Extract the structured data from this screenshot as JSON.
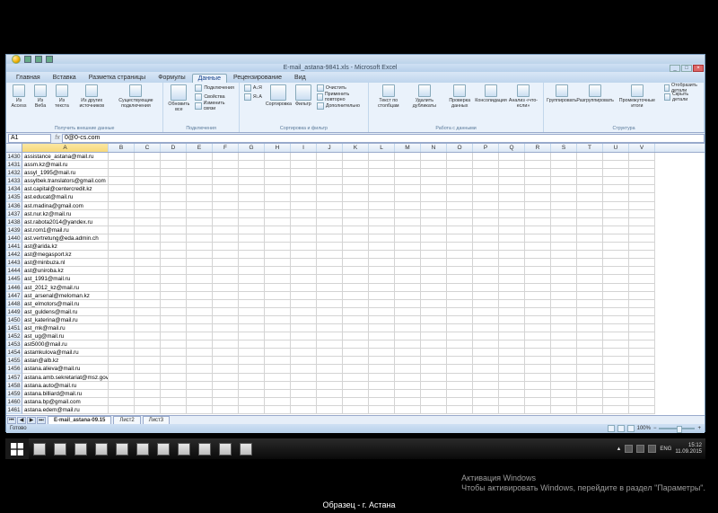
{
  "letterbox_caption": "Образец - г. Астана",
  "activation": {
    "title": "Активация Windows",
    "msg": "Чтобы активировать Windows, перейдите в раздел \"Параметры\"."
  },
  "window": {
    "doc_title": "E-mail_astana-9841.xls - Microsoft Excel",
    "min": "_",
    "max": "□",
    "close": "×"
  },
  "tabs": {
    "items": [
      "Главная",
      "Вставка",
      "Разметка страницы",
      "Формулы",
      "Данные",
      "Рецензирование",
      "Вид"
    ],
    "active_index": 4
  },
  "ribbon": {
    "g0": {
      "label": "Получить внешние данные",
      "b": [
        "Из Access",
        "Из Веба",
        "Из текста",
        "Из других источников",
        "Существующие подключения"
      ]
    },
    "g1": {
      "label": "Подключения",
      "big": "Обновить все",
      "s": [
        "Подключения",
        "Свойства",
        "Изменить связи"
      ]
    },
    "g2": {
      "label": "Сортировка и фильтр",
      "b": [
        "Сортировка",
        "Фильтр"
      ],
      "za": [
        "А↓Я",
        "Я↓А"
      ],
      "s": [
        "Очистить",
        "Применить повторно",
        "Дополнительно"
      ]
    },
    "g3": {
      "label": "Работа с данными",
      "b": [
        "Текст по столбцам",
        "Удалить дубликаты",
        "Проверка данных",
        "Консолидация",
        "Анализ «что-если»"
      ]
    },
    "g4": {
      "label": "Структура",
      "b": [
        "Группировать",
        "Разгруппировать",
        "Промежуточные итоги"
      ],
      "s": [
        "Отобразить детали",
        "Скрыть детали"
      ]
    }
  },
  "namebox": {
    "ref": "A1",
    "fx_label": "fx",
    "formula": "0@0-cs.com"
  },
  "columns": [
    "A",
    "B",
    "C",
    "D",
    "E",
    "F",
    "G",
    "H",
    "I",
    "J",
    "K",
    "L",
    "M",
    "N",
    "O",
    "P",
    "Q",
    "R",
    "S",
    "T",
    "U",
    "V"
  ],
  "rows_start": 1430,
  "cells_colA": [
    "assistance_astana@mail.ru",
    "assm.kz@mail.ru",
    "assyl_1995@mail.ru",
    "assylbek.translators@gmail.com",
    "ast.capital@centercredit.kz",
    "ast.educat@mail.ru",
    "ast.madina@gmail.com",
    "ast.nur.kz@mail.ru",
    "ast.rabota2014@yandex.ru",
    "ast.rom1@mail.ru",
    "ast.vertretung@eda.admin.ch",
    "ast@arida.kz",
    "ast@megasport.kz",
    "ast@minbuza.nl",
    "ast@uniroba.kz",
    "ast_1991@mail.ru",
    "ast_2012_kz@mail.ru",
    "ast_arsenal@meloman.kz",
    "ast_elmotors@mail.ru",
    "ast_guldens@mail.ru",
    "ast_katerina@mail.ru",
    "ast_mk@mail.ru",
    "ast_ug@mail.ru",
    "ast5000@mail.ru",
    "astamkulova@mail.ru",
    "astan@alb.kz",
    "astana.alieva@mail.ru",
    "astana.amb.sekretariat@msz.gov.pl",
    "astana.auto@mail.ru",
    "astana.billiard@mail.ru",
    "astana.bp@gmail.com",
    "astana.edem@mail.ru"
  ],
  "sheet_tabs": {
    "items": [
      "E-mail_astana-09.15",
      "Лист2",
      "Лист3"
    ],
    "active_index": 0
  },
  "status": {
    "ready": "Готово",
    "zoom": "100%"
  },
  "taskbar": {
    "icons": [
      "start",
      "ie",
      "explorer",
      "store",
      "word",
      "chrome",
      "paint",
      "folder1",
      "folder2",
      "vlc",
      "winamp",
      "excel"
    ],
    "tray": {
      "chevron": "▲",
      "flag": "⚑",
      "net": "▯",
      "snd": "🔊",
      "lang": "ENG",
      "time": "15:12",
      "date": "11.09.2015"
    }
  }
}
